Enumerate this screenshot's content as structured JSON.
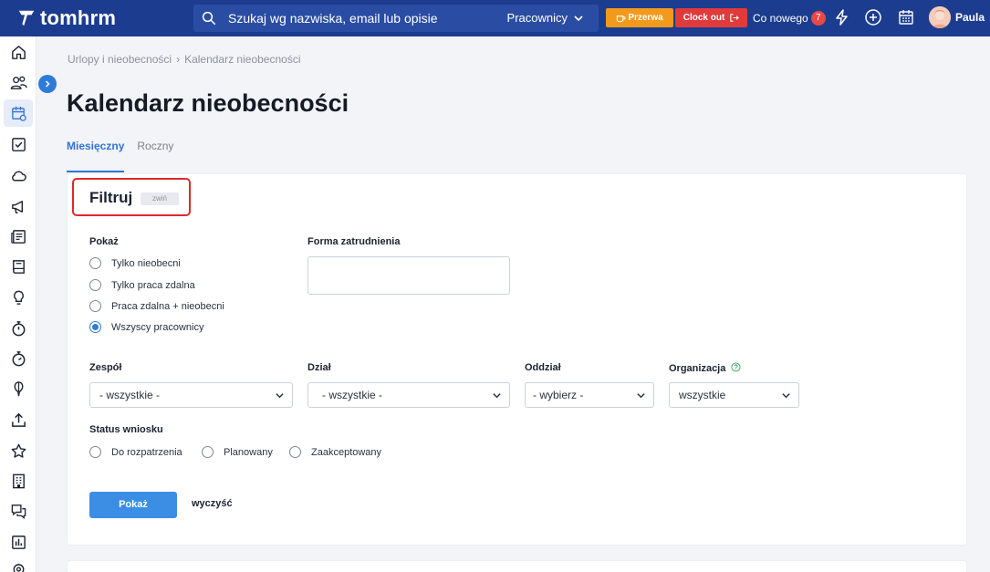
{
  "app": {
    "brand": "tomhrm",
    "colors": {
      "topbar": "#1c3d8f",
      "accent": "#2f73d6",
      "break": "#f39a1d",
      "clockout": "#e03a3a",
      "highlight": "#e0282d"
    }
  },
  "header": {
    "search_placeholder": "Szukaj wg nazwiska, email lub opisie",
    "search_scope": "Pracownicy",
    "break_label": "Przerwa",
    "clockout_label": "Clock out",
    "whats_new_label": "Co nowego",
    "whats_new_count": "7",
    "user_name": "Paula"
  },
  "sidebar": {
    "icons": [
      "home-icon",
      "users-icon",
      "calendar-icon",
      "checkbox-icon",
      "cloud-icon",
      "megaphone-icon",
      "news-icon",
      "book-icon",
      "lightbulb-icon",
      "stopwatch-icon",
      "timer-icon",
      "balloon-icon",
      "upload-icon",
      "star-icon",
      "building-icon",
      "chat-icon",
      "report-icon",
      "location-icon"
    ]
  },
  "breadcrumb": {
    "parent": "Urlopy i nieobecności",
    "current": "Kalendarz nieobecności"
  },
  "page": {
    "title": "Kalendarz nieobecności"
  },
  "tabs": [
    {
      "label": "Miesięczny",
      "active": true
    },
    {
      "label": "Roczny",
      "active": false
    }
  ],
  "filter": {
    "title": "Filtruj",
    "toggle_label": "zwiń",
    "show": {
      "label": "Pokaż",
      "options": [
        {
          "label": "Tylko nieobecni",
          "checked": false
        },
        {
          "label": "Tylko praca zdalna",
          "checked": false
        },
        {
          "label": "Praca zdalna + nieobecni",
          "checked": false
        },
        {
          "label": "Wszyscy pracownicy",
          "checked": true
        }
      ]
    },
    "employment": {
      "label": "Forma zatrudnienia",
      "value": ""
    },
    "team": {
      "label": "Zespół",
      "value": "- wszystkie -"
    },
    "department": {
      "label": "Dział",
      "value": "- wszystkie -"
    },
    "branch": {
      "label": "Oddział",
      "value": "- wybierz -"
    },
    "organization": {
      "label": "Organizacja",
      "value": "wszystkie"
    },
    "status": {
      "label": "Status wniosku",
      "options": [
        {
          "label": "Do rozpatrzenia",
          "checked": false
        },
        {
          "label": "Planowany",
          "checked": false
        },
        {
          "label": "Zaakceptowany",
          "checked": false
        }
      ]
    },
    "submit_label": "Pokaż",
    "clear_label": "wyczyść"
  }
}
